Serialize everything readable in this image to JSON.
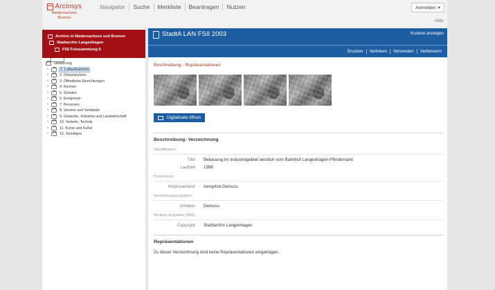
{
  "header": {
    "logo_name": "Arcinsys",
    "logo_sub": "Niedersachsen\nBremen",
    "nav": [
      "Navigator",
      "Suche",
      "Merkliste",
      "Beantragen",
      "Nutzen"
    ],
    "login": "Anmelden",
    "help": "Hilfe"
  },
  "left": {
    "breadcrumb": [
      "Archive in Niedersachsen und Bremen",
      "Stadtarchiv Langenhagen",
      "FSII Fotosammlung II"
    ],
    "tree_root": "Gliederung",
    "tree_items": [
      "1. Luftaufnahmen",
      "2. Ortsansichten",
      "3. Öffentliche Einrichtungen",
      "4. Kirchen",
      "5. Schulen",
      "6. Ereignisse",
      "7. Personen",
      "8. Vereine und Verbände",
      "9. Gewerbe, Industrie und Landwirtschaft",
      "10. Verkehr, Technik",
      "11. Kunst und Kultur",
      "12. Sonstiges"
    ],
    "selected_index": 0
  },
  "right": {
    "title": "StadtA LAN FSII 2003",
    "context": "Kontext anzeigen",
    "actions": [
      "Drucken",
      "Verlinken",
      "Versenden",
      "Verbessern"
    ],
    "section_label": "Beschreibung - Repräsentationen",
    "digital_button": "Digitalisate öffnen",
    "subhead": "Beschreibung: Verzeichnung",
    "groups": {
      "identification": "Identifikation",
      "provenance": "Provenienz",
      "production": "Herstellungsangaben",
      "further": "Weitere Angaben (Bild)"
    },
    "fields": {
      "titel_k": "Titel",
      "titel_v": "Bebauung im Industriegebiet westlich vom Bahnhof Langenhagen-Pferdemarkt",
      "laufzeit_k": "Laufzeit",
      "laufzeit_v": "1998",
      "vorprovenienz_k": "Vorprovenienz",
      "vorprovenienz_v": "Aerophot-Demuss",
      "urheber_k": "Urheber",
      "urheber_v": "Demuss",
      "copyright_k": "Copyright",
      "copyright_v": "Stadtarchiv Langenhagen"
    },
    "rep_head": "Repräsentationen",
    "rep_text": "Zu dieser Verzeichnung sind keine Repräsentationen eingetragen."
  }
}
